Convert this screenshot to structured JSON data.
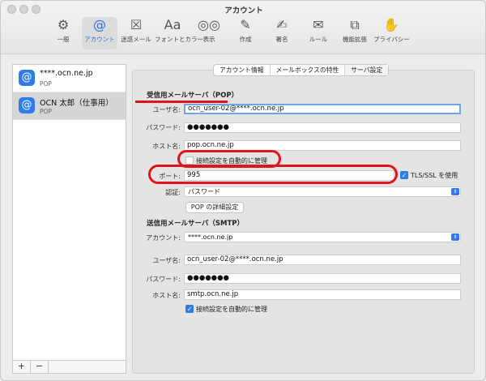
{
  "window": {
    "title": "アカウント"
  },
  "toolbar": [
    {
      "name": "toolbar-general",
      "icon": "⚙",
      "icon_name": "gear-icon",
      "label": "一般"
    },
    {
      "name": "toolbar-accounts",
      "icon": "@",
      "icon_name": "at-icon",
      "label": "アカウント",
      "active": true
    },
    {
      "name": "toolbar-junk",
      "icon": "☒",
      "icon_name": "junk-mail-icon",
      "label": "迷惑メール"
    },
    {
      "name": "toolbar-fonts",
      "icon": "Aa",
      "icon_name": "font-icon",
      "label": "フォントとカラー"
    },
    {
      "name": "toolbar-viewing",
      "icon": "◎◎",
      "icon_name": "glasses-icon",
      "label": "表示"
    },
    {
      "name": "toolbar-composing",
      "icon": "✎",
      "icon_name": "compose-icon",
      "label": "作成"
    },
    {
      "name": "toolbar-signatures",
      "icon": "✍",
      "icon_name": "signature-icon",
      "label": "署名"
    },
    {
      "name": "toolbar-rules",
      "icon": "✉",
      "icon_name": "rules-icon",
      "label": "ルール"
    },
    {
      "name": "toolbar-extensions",
      "icon": "⧉",
      "icon_name": "puzzle-icon",
      "label": "機能拡張"
    },
    {
      "name": "toolbar-privacy",
      "icon": "✋",
      "icon_name": "hand-icon",
      "label": "プライバシー"
    }
  ],
  "accounts": [
    {
      "name": "****.ocn.ne.jp",
      "type": "POP",
      "selected": false
    },
    {
      "name": "OCN 太郎（仕事用）",
      "type": "POP",
      "selected": true
    }
  ],
  "sidebar_buttons": {
    "add": "+",
    "remove": "−"
  },
  "tabs": [
    "アカウント情報",
    "メールボックスの特性",
    "サーバ設定"
  ],
  "active_tab": 2,
  "incoming": {
    "section_title": "受信用メールサーバ（POP）",
    "username_label": "ユーザ名:",
    "username": "ocn_user-02@****.ocn.ne.jp",
    "password_label": "パスワード:",
    "password": "●●●●●●●",
    "host_label": "ホスト名:",
    "host": "pop.ocn.ne.jp",
    "auto_manage_label": "接続設定を自動的に管理",
    "auto_manage": false,
    "port_label": "ポート:",
    "port": "995",
    "tls_label": "TLS/SSL を使用",
    "tls": true,
    "auth_label": "認証:",
    "auth": "パスワード",
    "advanced_button": "POP の詳細設定"
  },
  "outgoing": {
    "section_title": "送信用メールサーバ（SMTP）",
    "account_label": "アカウント:",
    "account": "****.ocn.ne.jp",
    "username_label": "ユーザ名:",
    "username": "ocn_user-02@****.ocn.ne.jp",
    "password_label": "パスワード:",
    "password": "●●●●●●●",
    "host_label": "ホスト名:",
    "host": "smtp.ocn.ne.jp",
    "auto_manage_label": "接続設定を自動的に管理",
    "auto_manage": true
  },
  "colors": {
    "accent": "#2f7be8",
    "highlight": "#e0141b"
  }
}
